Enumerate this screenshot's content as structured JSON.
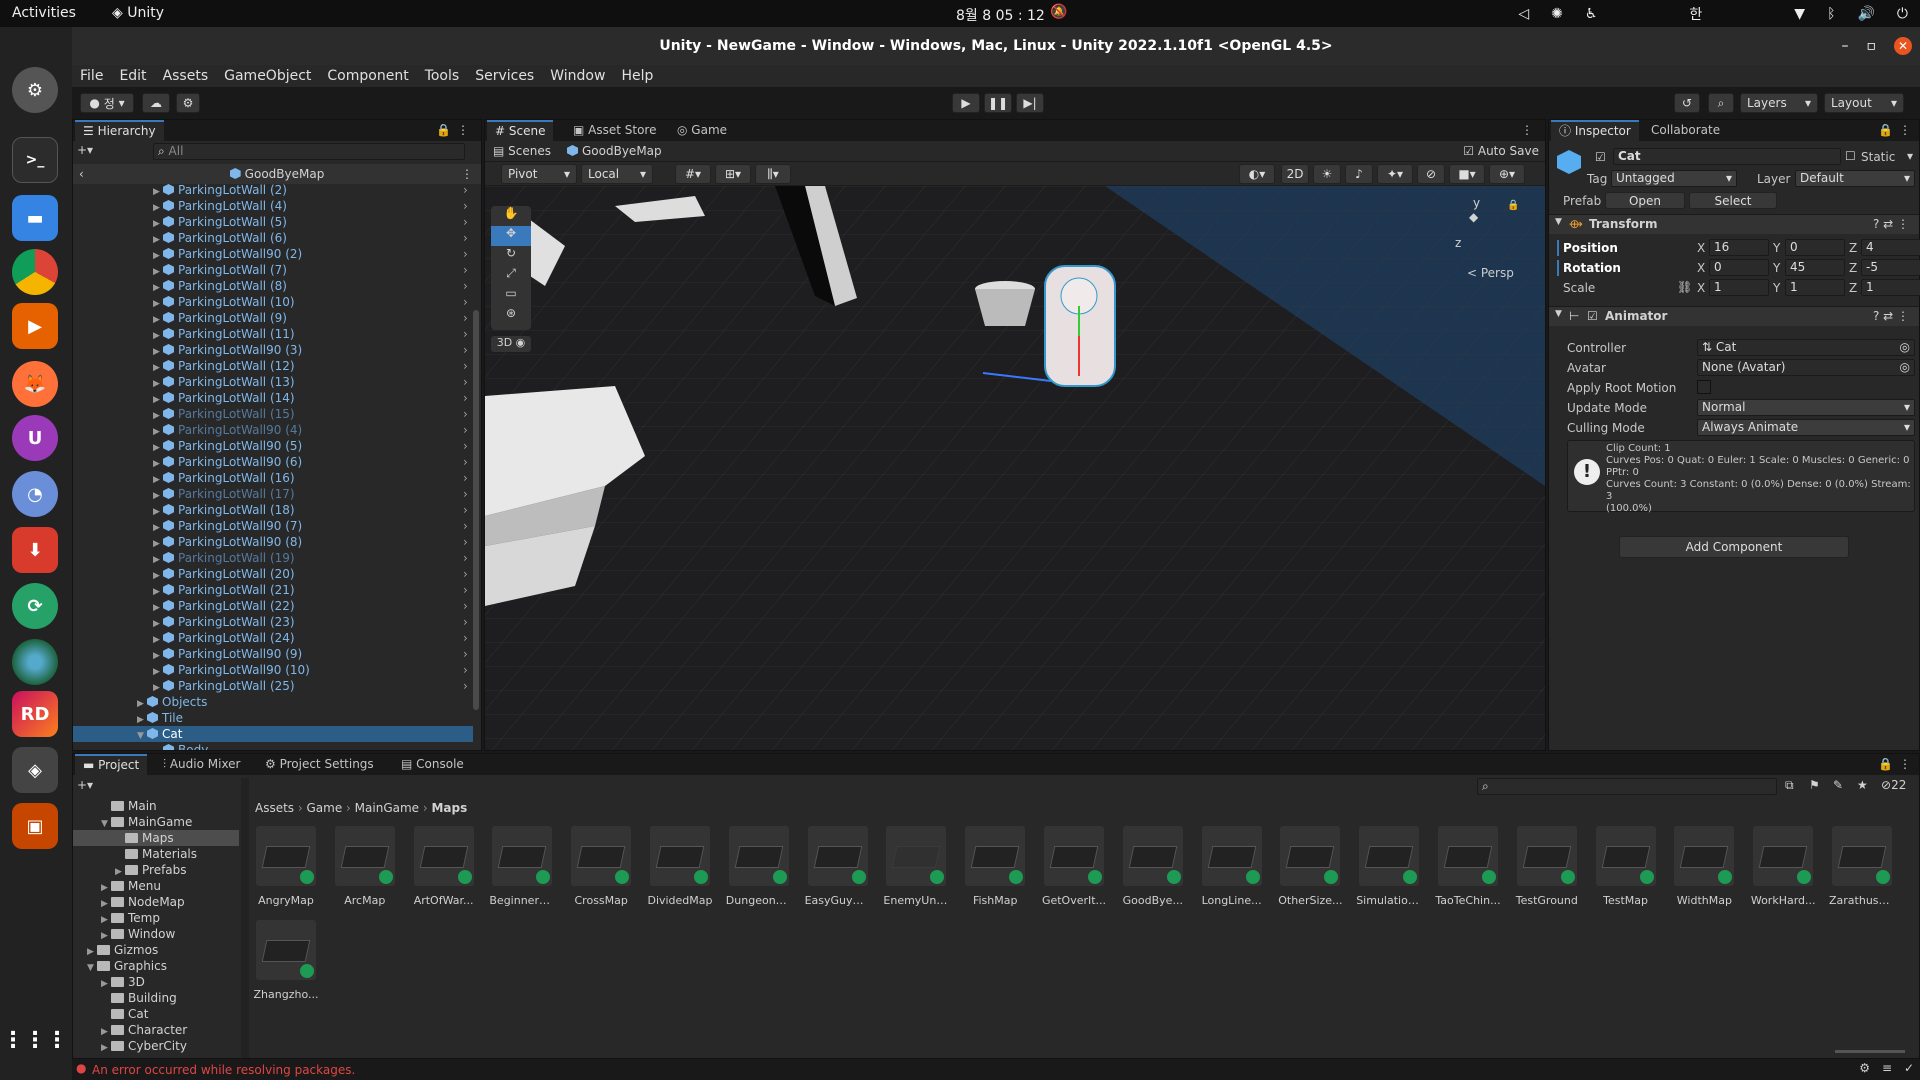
{
  "system": {
    "activities": "Activities",
    "app_name": "Unity",
    "clock": "8월 8  05 : 12",
    "ime": "한"
  },
  "window": {
    "title": "Unity - NewGame - Window - Windows, Mac, Linux - Unity 2022.1.10f1 <OpenGL 4.5>"
  },
  "menu": [
    "File",
    "Edit",
    "Assets",
    "GameObject",
    "Component",
    "Tools",
    "Services",
    "Window",
    "Help"
  ],
  "toolbar": {
    "account": "정",
    "layers": "Layers",
    "layout": "Layout"
  },
  "hierarchy": {
    "tab": "Hierarchy",
    "search_placeholder": "All",
    "scene": "GoodByeMap",
    "items": [
      {
        "label": "ParkingLotWall (2)",
        "dim": false
      },
      {
        "label": "ParkingLotWall (4)",
        "dim": false
      },
      {
        "label": "ParkingLotWall (5)",
        "dim": false
      },
      {
        "label": "ParkingLotWall (6)",
        "dim": false
      },
      {
        "label": "ParkingLotWall90 (2)",
        "dim": false
      },
      {
        "label": "ParkingLotWall (7)",
        "dim": false
      },
      {
        "label": "ParkingLotWall (8)",
        "dim": false
      },
      {
        "label": "ParkingLotWall (10)",
        "dim": false
      },
      {
        "label": "ParkingLotWall (9)",
        "dim": false
      },
      {
        "label": "ParkingLotWall (11)",
        "dim": false
      },
      {
        "label": "ParkingLotWall90 (3)",
        "dim": false
      },
      {
        "label": "ParkingLotWall (12)",
        "dim": false
      },
      {
        "label": "ParkingLotWall (13)",
        "dim": false
      },
      {
        "label": "ParkingLotWall (14)",
        "dim": false
      },
      {
        "label": "ParkingLotWall (15)",
        "dim": true
      },
      {
        "label": "ParkingLotWall90 (4)",
        "dim": true
      },
      {
        "label": "ParkingLotWall90 (5)",
        "dim": false
      },
      {
        "label": "ParkingLotWall90 (6)",
        "dim": false
      },
      {
        "label": "ParkingLotWall (16)",
        "dim": false
      },
      {
        "label": "ParkingLotWall (17)",
        "dim": true
      },
      {
        "label": "ParkingLotWall (18)",
        "dim": false
      },
      {
        "label": "ParkingLotWall90 (7)",
        "dim": false
      },
      {
        "label": "ParkingLotWall90 (8)",
        "dim": false
      },
      {
        "label": "ParkingLotWall (19)",
        "dim": true
      },
      {
        "label": "ParkingLotWall (20)",
        "dim": false
      },
      {
        "label": "ParkingLotWall (21)",
        "dim": false
      },
      {
        "label": "ParkingLotWall (22)",
        "dim": false
      },
      {
        "label": "ParkingLotWall (23)",
        "dim": false
      },
      {
        "label": "ParkingLotWall (24)",
        "dim": false
      },
      {
        "label": "ParkingLotWall90 (9)",
        "dim": false
      },
      {
        "label": "ParkingLotWall90 (10)",
        "dim": false
      },
      {
        "label": "ParkingLotWall (25)",
        "dim": false
      }
    ],
    "objects": "Objects",
    "tile": "Tile",
    "cat": "Cat",
    "body": "Body"
  },
  "scene": {
    "tabs": [
      "Scene",
      "Asset Store",
      "Game"
    ],
    "breadcrumb_root": "Scenes",
    "breadcrumb_scene": "GoodByeMap",
    "auto_save": "Auto Save",
    "pivot": "Pivot",
    "local": "Local",
    "mode_2d": "2D",
    "persp": "< Persp",
    "gizmo_y": "y",
    "gizmo_z": "z",
    "tool_3d": "3D"
  },
  "inspector": {
    "tabs": [
      "Inspector",
      "Collaborate"
    ],
    "object_name": "Cat",
    "static": "Static",
    "tag_label": "Tag",
    "tag_value": "Untagged",
    "layer_label": "Layer",
    "layer_value": "Default",
    "prefab_label": "Prefab",
    "open": "Open",
    "select": "Select",
    "transform": {
      "title": "Transform",
      "position": {
        "label": "Position",
        "x": "16",
        "y": "0",
        "z": "4"
      },
      "rotation": {
        "label": "Rotation",
        "x": "0",
        "y": "45",
        "z": "-5"
      },
      "scale": {
        "label": "Scale",
        "x": "1",
        "y": "1",
        "z": "1"
      }
    },
    "animator": {
      "title": "Animator",
      "controller_label": "Controller",
      "controller_value": "Cat",
      "avatar_label": "Avatar",
      "avatar_value": "None (Avatar)",
      "root_motion_label": "Apply Root Motion",
      "update_mode_label": "Update Mode",
      "update_mode_value": "Normal",
      "culling_mode_label": "Culling Mode",
      "culling_mode_value": "Always Animate",
      "info_lines": [
        "Clip Count: 1",
        "Curves Pos: 0 Quat: 0 Euler: 1 Scale: 0 Muscles: 0 Generic: 0",
        "PPtr: 0",
        "Curves Count: 3 Constant: 0 (0.0%) Dense: 0 (0.0%) Stream: 3",
        "(100.0%)"
      ]
    },
    "add_component": "Add Component"
  },
  "project": {
    "tabs": [
      "Project",
      "Audio Mixer",
      "Project Settings",
      "Console"
    ],
    "tree": [
      {
        "label": "Main",
        "indent": 2,
        "arrow": ""
      },
      {
        "label": "MainGame",
        "indent": 2,
        "arrow": "▼"
      },
      {
        "label": "Maps",
        "indent": 3,
        "arrow": "",
        "selected": true
      },
      {
        "label": "Materials",
        "indent": 3,
        "arrow": ""
      },
      {
        "label": "Prefabs",
        "indent": 3,
        "arrow": "▶"
      },
      {
        "label": "Menu",
        "indent": 2,
        "arrow": "▶"
      },
      {
        "label": "NodeMap",
        "indent": 2,
        "arrow": "▶"
      },
      {
        "label": "Temp",
        "indent": 2,
        "arrow": "▶"
      },
      {
        "label": "Window",
        "indent": 2,
        "arrow": "▶"
      },
      {
        "label": "Gizmos",
        "indent": 1,
        "arrow": "▶"
      },
      {
        "label": "Graphics",
        "indent": 1,
        "arrow": "▼"
      },
      {
        "label": "3D",
        "indent": 2,
        "arrow": "▶"
      },
      {
        "label": "Building",
        "indent": 2,
        "arrow": ""
      },
      {
        "label": "Cat",
        "indent": 2,
        "arrow": ""
      },
      {
        "label": "Character",
        "indent": 2,
        "arrow": "▶"
      },
      {
        "label": "CyberCity",
        "indent": 2,
        "arrow": "▶"
      }
    ],
    "breadcrumb": [
      "Assets",
      "Game",
      "MainGame",
      "Maps"
    ],
    "count": "22",
    "assets": [
      "AngryMap",
      "ArcMap",
      "ArtOfWar...",
      "BeginnerM...",
      "CrossMap",
      "DividedMap",
      "DungeonM...",
      "EasyGuyM...",
      "EnemyUnit...",
      "FishMap",
      "GetOverIt...",
      "GoodBye...",
      "LongLine...",
      "OtherSize...",
      "Simulation...",
      "TaoTeChin...",
      "TestGround",
      "TestMap",
      "WidthMap",
      "WorkHard...",
      "Zarathusht...",
      "Zhangzho..."
    ]
  },
  "status": {
    "error": "An error occurred while resolving packages."
  },
  "colors": {
    "accent": "#3a79bb",
    "link_blue": "#7fb7ea",
    "error_red": "#e04545",
    "ubuntu_orange": "#e95420"
  }
}
